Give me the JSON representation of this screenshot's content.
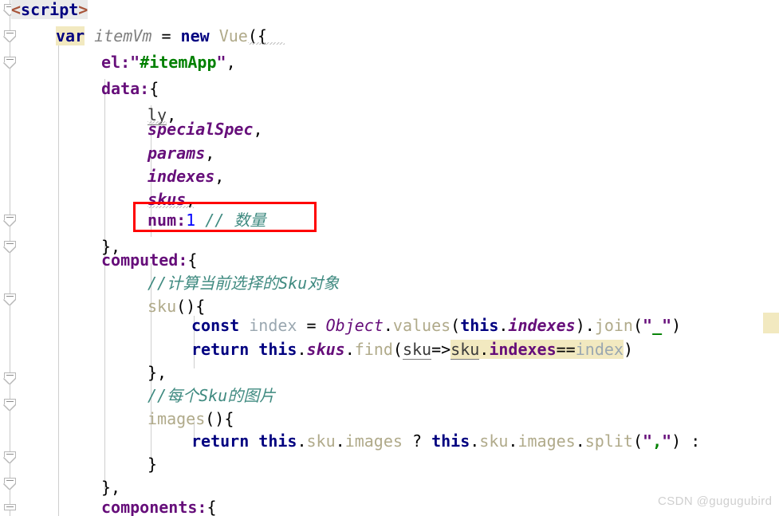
{
  "editor": {
    "language": "javascript",
    "watermark": "CSDN @gugugubird",
    "colors": {
      "background": "#ffffff",
      "keyword": "#000080",
      "property": "#660e7a",
      "string": "#008000",
      "comment": "#3f8a80",
      "number": "#0000ff",
      "function": "#b0aa8a",
      "identifier": "#808080",
      "tag_punctuation": "#a8553a",
      "annotation_box": "#ff0000",
      "search_highlight": "#f2e9c0",
      "indent_guide": "#cfcfcf"
    }
  },
  "code_lines": [
    {
      "n": 1,
      "indent": 0,
      "text": "<script>"
    },
    {
      "n": 2,
      "indent": 1,
      "text": "var itemVm = new Vue({"
    },
    {
      "n": 3,
      "indent": 2,
      "text": "el:\"#itemApp\","
    },
    {
      "n": 4,
      "indent": 2,
      "text": "data:{"
    },
    {
      "n": 5,
      "indent": 3,
      "text": "ly,"
    },
    {
      "n": 6,
      "indent": 3,
      "text": "specialSpec,"
    },
    {
      "n": 7,
      "indent": 3,
      "text": "params,"
    },
    {
      "n": 8,
      "indent": 3,
      "text": "indexes,"
    },
    {
      "n": 9,
      "indent": 3,
      "text": "skus,"
    },
    {
      "n": 10,
      "indent": 3,
      "text": "num:1 // 数量"
    },
    {
      "n": 11,
      "indent": 2,
      "text": "},"
    },
    {
      "n": 12,
      "indent": 2,
      "text": "computed:{"
    },
    {
      "n": 13,
      "indent": 3,
      "text": "//计算当前选择的Sku对象"
    },
    {
      "n": 14,
      "indent": 3,
      "text": "sku(){"
    },
    {
      "n": 15,
      "indent": 4,
      "text": "const index = Object.values(this.indexes).join(\"_\")"
    },
    {
      "n": 16,
      "indent": 4,
      "text": "return this.skus.find(sku=>sku.indexes==index)"
    },
    {
      "n": 17,
      "indent": 3,
      "text": "},"
    },
    {
      "n": 18,
      "indent": 3,
      "text": "//每个Sku的图片"
    },
    {
      "n": 19,
      "indent": 3,
      "text": "images(){"
    },
    {
      "n": 20,
      "indent": 4,
      "text": "return this.sku.images ? this.sku.images.split(\",\") :"
    },
    {
      "n": 21,
      "indent": 3,
      "text": "}"
    },
    {
      "n": 22,
      "indent": 2,
      "text": "},"
    },
    {
      "n": 23,
      "indent": 2,
      "text": "components:{"
    }
  ],
  "tokens": {
    "script_open_lt": "<",
    "script_open_name": "script",
    "script_open_gt": ">",
    "kw_var": "var",
    "id_itemVm": "itemVm",
    "op_eq": " = ",
    "kw_new": "new",
    "id_Vue": "Vue",
    "punc_paren_brace_open": "({",
    "prop_el": "el",
    "colon": ":",
    "quote": "\"",
    "str_itemApp": "#itemApp",
    "comma": ",",
    "prop_data": "data",
    "brace_open": "{",
    "field_ly": "ly",
    "field_specialSpec": "specialSpec",
    "field_params": "params",
    "field_indexes": "indexes",
    "field_skus": "skus",
    "prop_num": "num",
    "num_one": "1",
    "cmt_quantity": "// 数量",
    "brace_close_comma": "},",
    "prop_computed": "computed",
    "cmt_sku_object": "//计算当前选择的Sku对象",
    "fn_sku": "sku",
    "parens_brace": "(){",
    "kw_const": "const",
    "id_index": "index",
    "cls_Object": "Object",
    "dot": ".",
    "fn_values": "values",
    "paren_open": "(",
    "kw_this": "this",
    "prop_indexes_b": "indexes",
    "paren_close": ")",
    "fn_join": "join",
    "str_underscore": "_",
    "kw_return": "return",
    "prop_skus_b": "skus",
    "fn_find": "find",
    "arg_sku": "sku",
    "arrow": "=>",
    "hl_sku": "sku",
    "hl_indexes": "indexes",
    "hl_eqeq": "==",
    "hl_index": "index",
    "brace_close": "}",
    "cmt_sku_image": "//每个Sku的图片",
    "fn_images": "images",
    "prop_sku_plain": "sku",
    "prop_images_plain": "images",
    "op_question": "?",
    "fn_split": "split",
    "str_comma": ",",
    "op_colon_tail": ":",
    "prop_components": "components"
  }
}
